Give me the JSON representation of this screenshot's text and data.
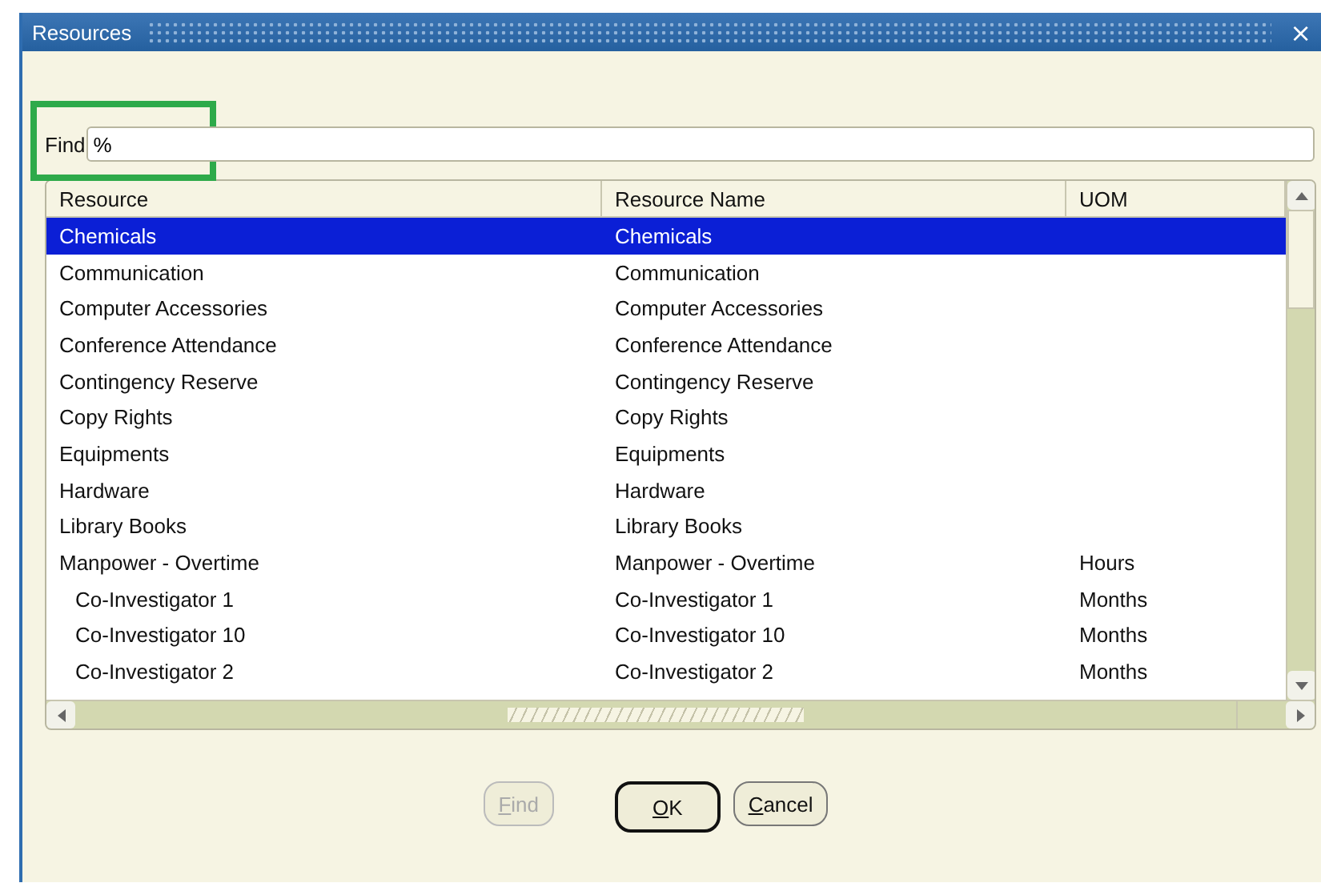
{
  "window": {
    "title": "Resources",
    "close": "×"
  },
  "find": {
    "label": "Find",
    "value": "%",
    "highlighted": true
  },
  "table": {
    "columns": [
      "Resource",
      "Resource Name",
      "UOM"
    ],
    "rows": [
      {
        "resource": "Chemicals",
        "name": "Chemicals",
        "uom": "",
        "selected": true
      },
      {
        "resource": "Communication",
        "name": "Communication",
        "uom": "",
        "selected": false
      },
      {
        "resource": "Computer Accessories",
        "name": "Computer Accessories",
        "uom": "",
        "selected": false
      },
      {
        "resource": "Conference Attendance",
        "name": "Conference Attendance",
        "uom": "",
        "selected": false
      },
      {
        "resource": "Contingency Reserve",
        "name": "Contingency Reserve",
        "uom": "",
        "selected": false
      },
      {
        "resource": "Copy Rights",
        "name": "Copy Rights",
        "uom": "",
        "selected": false
      },
      {
        "resource": "Equipments",
        "name": "Equipments",
        "uom": "",
        "selected": false
      },
      {
        "resource": "Hardware",
        "name": "Hardware",
        "uom": "",
        "selected": false
      },
      {
        "resource": "Library Books",
        "name": "Library Books",
        "uom": "",
        "selected": false
      },
      {
        "resource": "Manpower - Overtime",
        "name": "Manpower - Overtime",
        "uom": "Hours",
        "selected": false,
        "children": [
          {
            "resource": "Co-Investigator 1",
            "name": "Co-Investigator 1",
            "uom": "Months",
            "selected": false
          },
          {
            "resource": "Co-Investigator 10",
            "name": "Co-Investigator 10",
            "uom": "Months",
            "selected": false
          },
          {
            "resource": "Co-Investigator 2",
            "name": "Co-Investigator 2",
            "uom": "Months",
            "selected": false
          }
        ]
      }
    ]
  },
  "buttons": [
    {
      "label": "Find",
      "disabled": true,
      "default": false
    },
    {
      "label": "OK",
      "disabled": false,
      "default": true
    },
    {
      "label": "Cancel",
      "disabled": false,
      "default": false
    }
  ]
}
